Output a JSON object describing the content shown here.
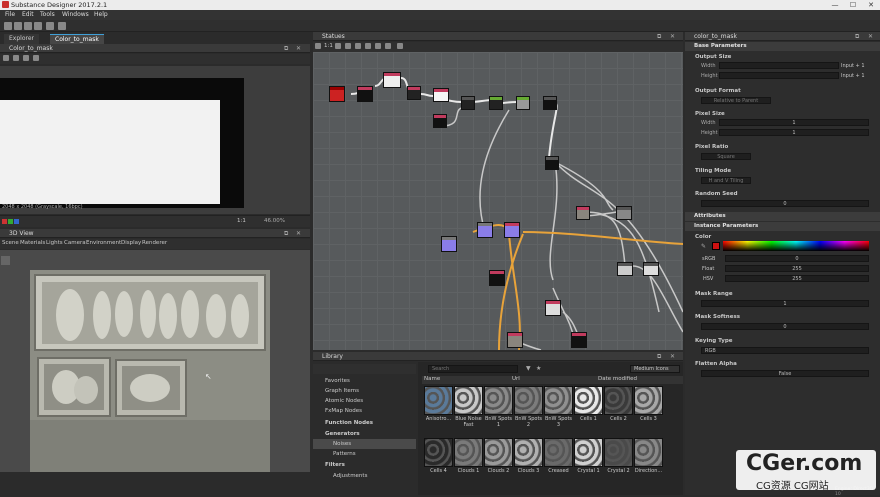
{
  "window": {
    "title": "Substance Designer 2017.2.1",
    "controls": [
      "—",
      "☐",
      "✕"
    ]
  },
  "menu": [
    "File",
    "Edit",
    "Tools",
    "Windows",
    "Help"
  ],
  "tabs": {
    "explorer": "Explorer",
    "graph": "Color_to_mask"
  },
  "panel_2d": {
    "title": "Color_to_mask",
    "status": "2048 x 2048 (Grayscale, 16bpc)",
    "zoom": "1:1",
    "percent": "46.00%"
  },
  "panel_3d": {
    "title": "3D View",
    "menu": [
      "Scene",
      "Materials",
      "Lights",
      "Camera",
      "Environment",
      "Display",
      "Renderer"
    ]
  },
  "graph_panel": {
    "title": "Statues",
    "zoom": "1:1"
  },
  "library": {
    "title": "Library",
    "search_placeholder": "Search",
    "view_mode": "Medium Icons",
    "columns": [
      "Name",
      "Url",
      "Date modified"
    ],
    "tree": [
      "Favorites",
      "Graph Items",
      "Atomic Nodes",
      "FxMap Nodes",
      "Function Nodes",
      "Generators",
      "Noises",
      "Patterns",
      "Filters",
      "Adjustments"
    ],
    "row1": [
      "Anisotro...",
      "Blue Noise Fast",
      "BnW Spots 1",
      "BnW Spots 2",
      "BnW Spots 3",
      "Cells 1",
      "Cells 2",
      "Cells 3"
    ],
    "row2": [
      "Cells 4",
      "Clouds 1",
      "Clouds 2",
      "Clouds 3",
      "Creased",
      "Crystal 1",
      "Crystal 2",
      "Direction..."
    ]
  },
  "properties": {
    "title": "color_to_mask",
    "base_parameters": "Base Parameters",
    "output_size": "Output Size",
    "width": "Width",
    "height": "Height",
    "input_plus_1": "Input + 1",
    "output_format": "Output Format",
    "output_format_value": "Relative to Parent",
    "pixel_size": "Pixel Size",
    "pixel_size_value": "1",
    "pixel_ratio": "Pixel Ratio",
    "pixel_ratio_value": "Square",
    "tiling_mode": "Tiling Mode",
    "tiling_mode_value": "H and V Tiling",
    "random_seed": "Random Seed",
    "random_seed_value": "0",
    "attributes": "Attributes",
    "instance_parameters": "Instance Parameters",
    "color": "Color",
    "accent_color": "#cc1111",
    "color_modes": [
      "sRGB",
      "Float",
      "HSV"
    ],
    "color_values": [
      "0",
      "255",
      "255"
    ],
    "flatten_range": "Mask Range",
    "mask_range_value": "1",
    "mask_softness": "Mask Softness",
    "mask_softness_value": "0",
    "keying_type": "Keying Type",
    "keying_type_value": "RGB",
    "flatten_alpha": "Flatten Alpha",
    "flatten_alpha_value": "False",
    "engine": "Engine: Direct3D 10"
  },
  "watermark": {
    "main": "CGer.com",
    "sub": "CG资源 CG网站"
  }
}
